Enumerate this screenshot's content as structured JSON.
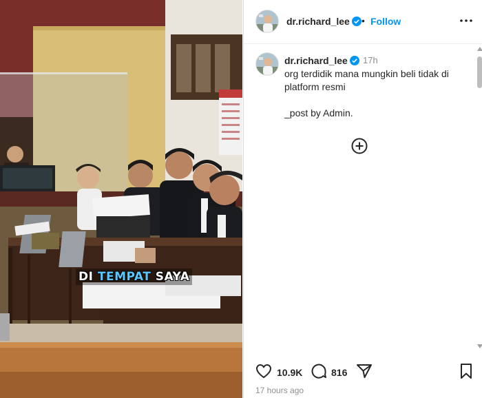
{
  "caption": {
    "part1": "DI ",
    "highlight": "TEMPAT",
    "part2": " SAYA"
  },
  "header": {
    "username": "dr.richard_lee",
    "separator": "•",
    "follow_label": "Follow"
  },
  "post": {
    "username": "dr.richard_lee",
    "time": "17h",
    "text": "org terdidik mana mungkin beli tidak di platform resmi\n\n_post by Admin."
  },
  "stats": {
    "likes": "10.9K",
    "comments": "816"
  },
  "footer": {
    "time_ago": "17 hours ago"
  },
  "colors": {
    "follow": "#0095f6",
    "verified": "#0095f6",
    "caption_highlight": "#59c8ff"
  },
  "icons": {
    "verified": "verified-badge-icon",
    "more": "more-options-icon",
    "add": "plus-circle-icon",
    "like": "heart-icon",
    "comment": "comment-icon",
    "share": "share-icon",
    "save": "bookmark-icon"
  }
}
